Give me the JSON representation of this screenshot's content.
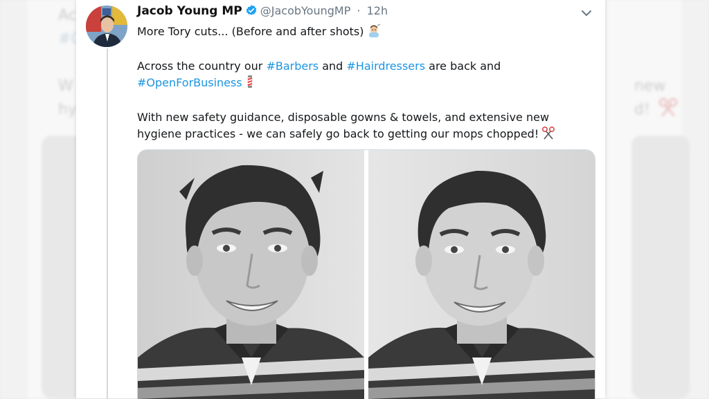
{
  "background": {
    "left_fragments": [
      "Ac",
      "#C",
      "W",
      "hy"
    ],
    "right_fragments": [
      "new",
      "d!"
    ]
  },
  "tweet": {
    "display_name": "Jacob Young MP",
    "handle": "@JacobYoungMP",
    "separator": "·",
    "time": "12h",
    "verified": true,
    "line1": "More Tory cuts... (Before and after shots)",
    "para2": {
      "prefix": "Across the country our ",
      "tag1": "#Barbers",
      "mid": " and ",
      "tag2": "#Hairdressers",
      "suffix": " are back and",
      "tag3": "#OpenForBusiness"
    },
    "para3": {
      "line1": "With new safety guidance, disposable gowns & towels, and extensive new",
      "line2": "hygiene practices - we can safely go back to getting our mops chopped!"
    },
    "media": {
      "left_photo": "before-photo",
      "right_photo": "after-photo"
    }
  },
  "icons": {
    "verified": "verified-badge-icon",
    "more": "chevron-down-icon",
    "emoji1": "man-getting-haircut-emoji-icon",
    "emoji2": "barber-pole-emoji-icon",
    "emoji3": "scissors-emoji-icon"
  },
  "colors": {
    "hashtag": "#1b95e0",
    "verified": "#1da1f2",
    "handle": "#687684"
  }
}
